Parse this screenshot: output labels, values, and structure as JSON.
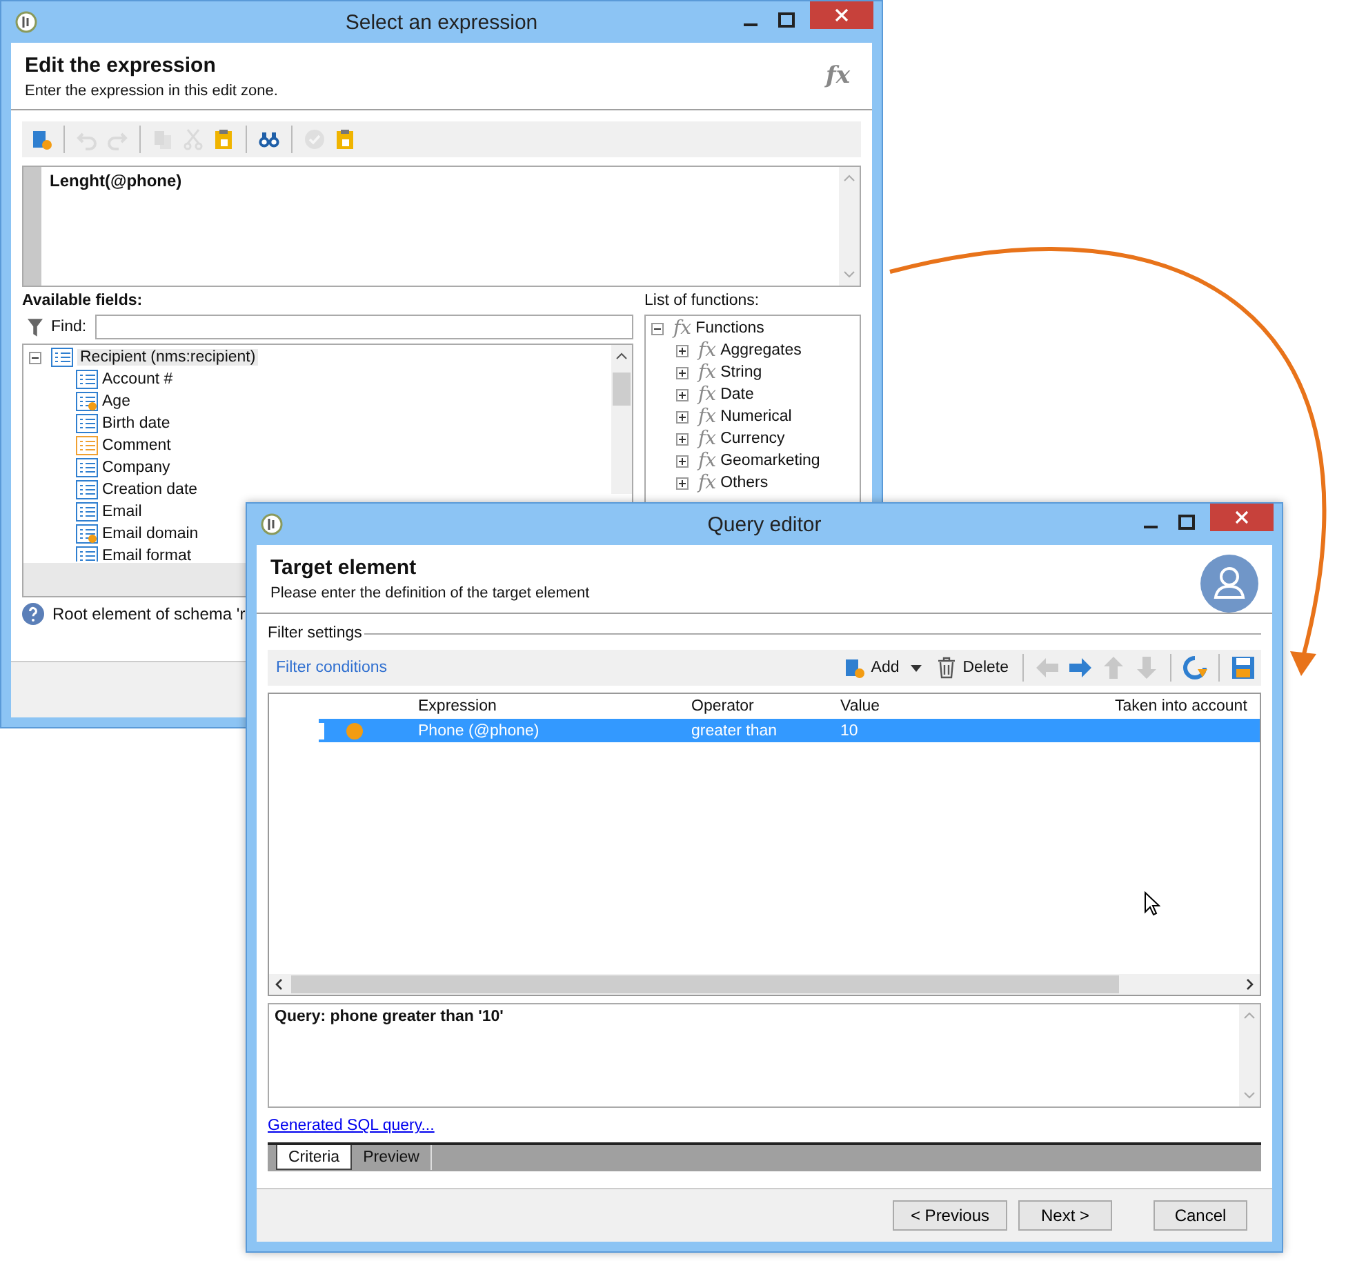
{
  "expression_window": {
    "title": "Select an expression",
    "heading": "Edit the expression",
    "subheading": "Enter the expression in this edit zone.",
    "header_glyph": "fx",
    "toolbar": [
      {
        "kind": "new",
        "disabled": false
      },
      {
        "kind": "sep"
      },
      {
        "kind": "undo",
        "disabled": true
      },
      {
        "kind": "redo",
        "disabled": true
      },
      {
        "kind": "sep"
      },
      {
        "kind": "copy",
        "disabled": true
      },
      {
        "kind": "cut",
        "disabled": true
      },
      {
        "kind": "paste",
        "disabled": false
      },
      {
        "kind": "sep"
      },
      {
        "kind": "find",
        "disabled": false
      },
      {
        "kind": "sep"
      },
      {
        "kind": "check",
        "disabled": true
      },
      {
        "kind": "paste",
        "disabled": false
      }
    ],
    "expression": "Lenght(@phone)",
    "available_fields": {
      "label": "Available fields:",
      "find_label": "Find:",
      "root": {
        "label": "Recipient (nms:recipient)",
        "expanded": true,
        "selected": true,
        "children": [
          {
            "label": "Account #",
            "kind": "field",
            "selected": false
          },
          {
            "label": "Age",
            "kind": "computed",
            "selected": false
          },
          {
            "label": "Birth date",
            "kind": "field",
            "selected": false
          },
          {
            "label": "Comment",
            "kind": "memo",
            "selected": false
          },
          {
            "label": "Company",
            "kind": "field",
            "selected": false
          },
          {
            "label": "Creation date",
            "kind": "field",
            "selected": false
          },
          {
            "label": "Email",
            "kind": "field",
            "selected": false
          },
          {
            "label": "Email domain",
            "kind": "computed",
            "selected": false
          },
          {
            "label": "Email format",
            "kind": "field",
            "selected": false
          }
        ]
      }
    },
    "functions": {
      "label": "List of functions:",
      "root": {
        "glyph": "fx",
        "label": "Functions",
        "expanded": true,
        "children": [
          {
            "glyph": "fx",
            "label": "Aggregates",
            "expanded": false
          },
          {
            "glyph": "fx",
            "label": "String",
            "expanded": false
          },
          {
            "glyph": "fx",
            "label": "Date",
            "expanded": false
          },
          {
            "glyph": "fx",
            "label": "Numerical",
            "expanded": false
          },
          {
            "glyph": "fx",
            "label": "Currency",
            "expanded": false
          },
          {
            "glyph": "fx",
            "label": "Geomarketing",
            "expanded": false
          },
          {
            "glyph": "fx",
            "label": "Others",
            "expanded": false
          }
        ]
      }
    },
    "help_text": "Root element of schema 'r"
  },
  "query_window": {
    "title": "Query editor",
    "heading": "Target element",
    "subheading": "Please enter the definition of the target element",
    "section_label": "Filter settings",
    "toolbar_label": "Filter conditions",
    "toolbar": [
      {
        "kind": "add",
        "label": "Add",
        "disabled": false
      },
      {
        "kind": "delete",
        "label": "Delete",
        "disabled": false
      },
      {
        "kind": "sep"
      },
      {
        "kind": "left",
        "disabled": true
      },
      {
        "kind": "right",
        "disabled": false
      },
      {
        "kind": "up",
        "disabled": true
      },
      {
        "kind": "down",
        "disabled": true
      },
      {
        "kind": "sep"
      },
      {
        "kind": "refresh",
        "disabled": false
      },
      {
        "kind": "sep"
      },
      {
        "kind": "save",
        "disabled": false
      }
    ],
    "columns": [
      "Expression",
      "Operator",
      "Value",
      "Taken into account"
    ],
    "rows": [
      {
        "color": "#f39c12",
        "expression": "Phone (@phone)",
        "operator": "greater than",
        "value": "10",
        "selected": true
      }
    ],
    "query_text": "Query: phone greater than '10'",
    "sql_link": "Generated SQL query...",
    "tabs": [
      {
        "label": "Criteria",
        "selected": true
      },
      {
        "label": "Preview",
        "selected": false
      }
    ],
    "buttons": [
      "< Previous",
      "Next >",
      "Cancel"
    ]
  }
}
